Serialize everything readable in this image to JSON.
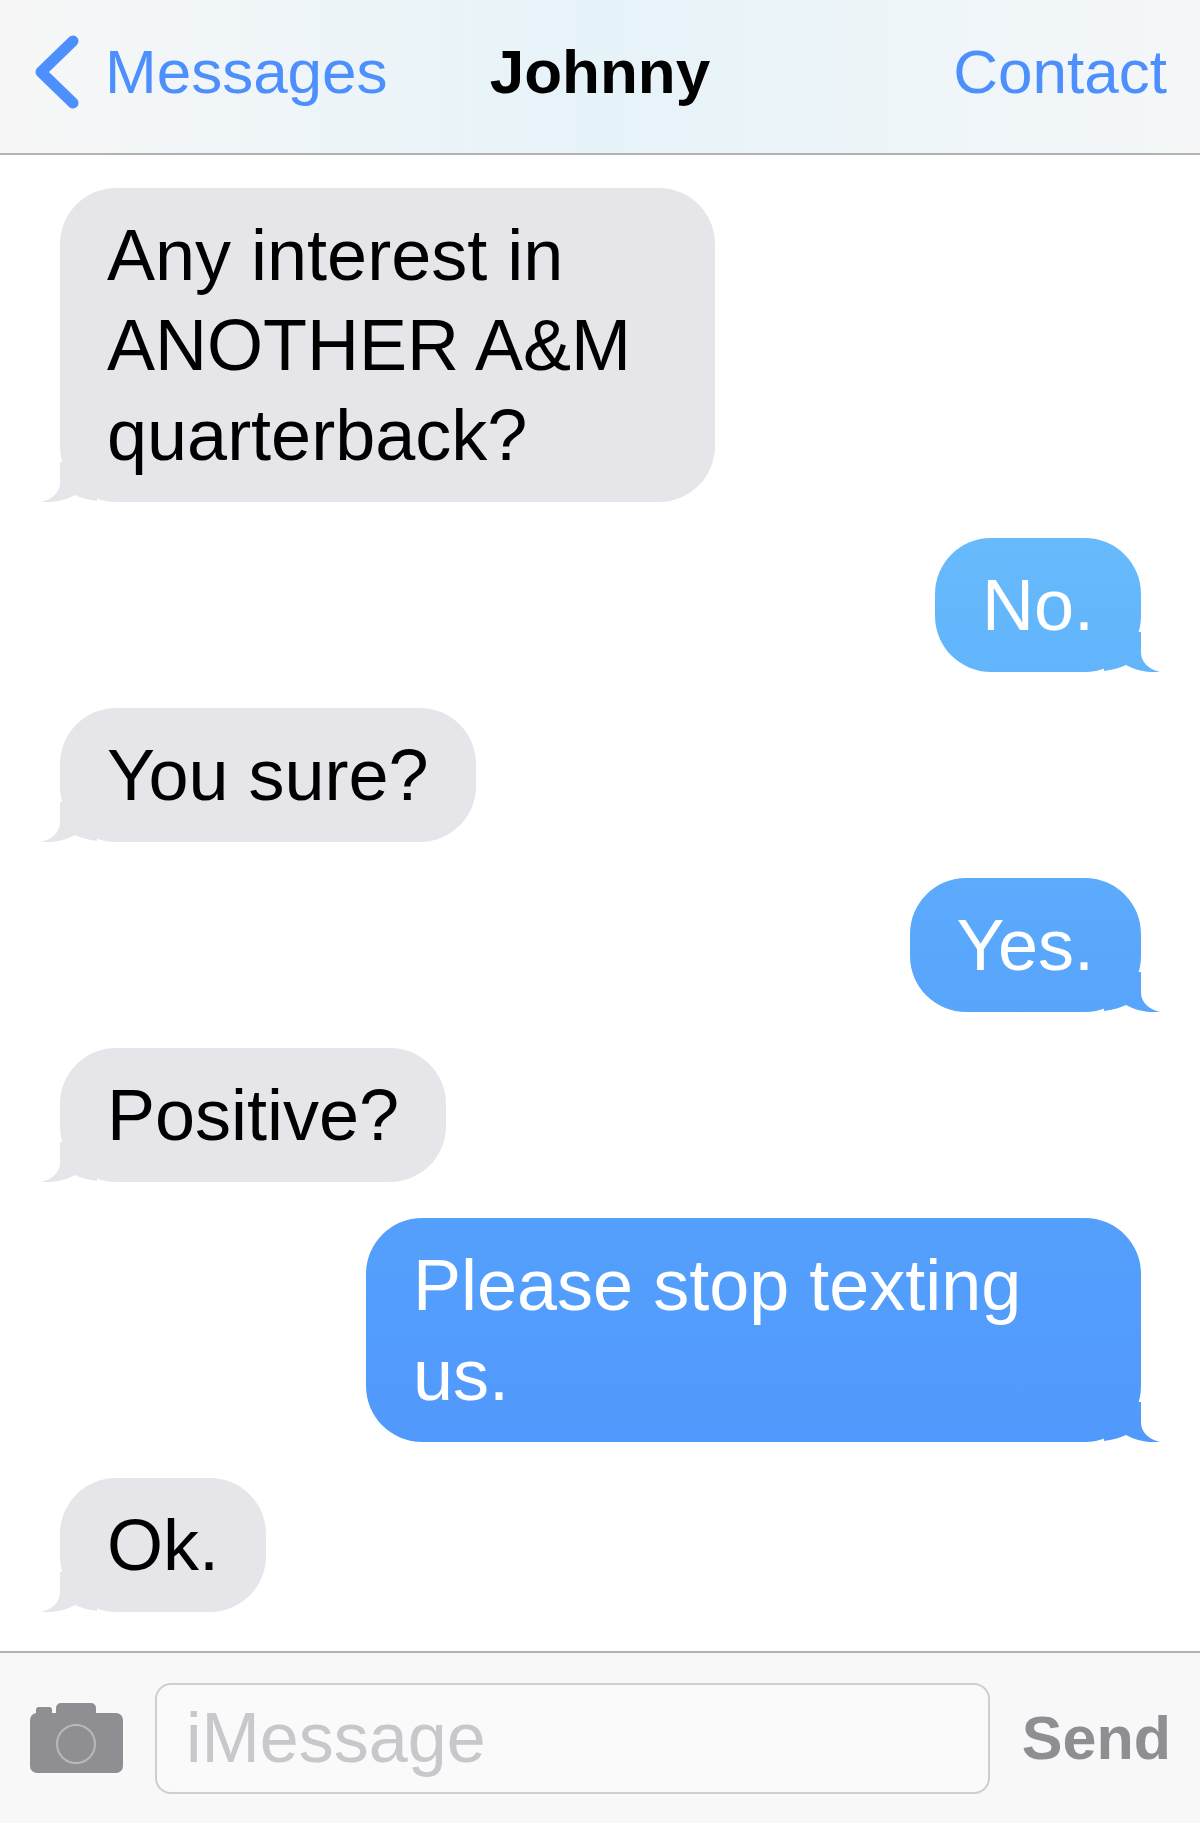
{
  "header": {
    "back_label": "Messages",
    "title": "Johnny",
    "action": "Contact"
  },
  "messages": [
    {
      "kind": "received",
      "text": "Any interest in ANOTHER A&M quarterback?"
    },
    {
      "kind": "sent",
      "text": "No."
    },
    {
      "kind": "received",
      "text": "You sure?"
    },
    {
      "kind": "sent",
      "text": "Yes."
    },
    {
      "kind": "received",
      "text": "Positive?"
    },
    {
      "kind": "sent",
      "text": "Please stop texting us."
    },
    {
      "kind": "received",
      "text": "Ok."
    }
  ],
  "composer": {
    "placeholder": "iMessage",
    "send_label": "Send"
  }
}
